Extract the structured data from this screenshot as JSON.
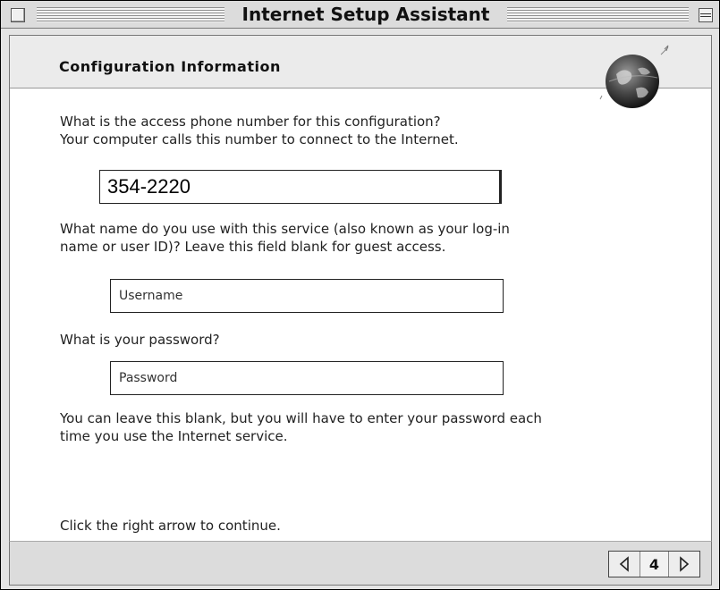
{
  "window": {
    "title": "Internet Setup Assistant"
  },
  "header": {
    "title": "Configuration Information",
    "logo_icon": "globe-icon"
  },
  "questions": {
    "phone_line1": "What is the access phone number for this configuration?",
    "phone_line2": "Your computer calls this number to connect to the Internet.",
    "name_line1": "What name do you use with this service (also known as your log-in",
    "name_line2": "name or user ID)?  Leave this field blank for guest access.",
    "password": "What is your password?",
    "password_note1": "You can leave this blank, but you will have to enter your password each",
    "password_note2": "time you use the Internet service.",
    "continue": "Click the right arrow to continue."
  },
  "fields": {
    "phone_value": "354-2220",
    "username_value": "Username",
    "password_value": "Password"
  },
  "footer": {
    "prev_icon": "left-arrow-icon",
    "page_number": "4",
    "next_icon": "right-arrow-icon"
  }
}
